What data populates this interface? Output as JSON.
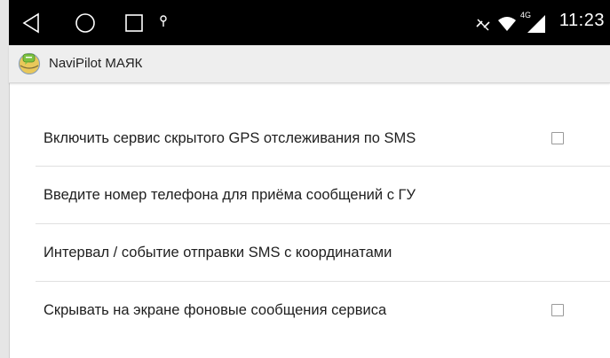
{
  "status_bar": {
    "time": "11:23",
    "network_type": "4G",
    "icons": [
      "back-icon",
      "home-icon",
      "recents-icon",
      "location-icon",
      "data-off-icon",
      "wifi-icon",
      "signal-icon"
    ]
  },
  "app_bar": {
    "title": "NaviPilot МАЯК"
  },
  "settings": {
    "items": [
      {
        "label": "Включить сервис скрытого GPS отслеживания по SMS",
        "has_checkbox": true,
        "checked": false
      },
      {
        "label": "Введите номер телефона для приёма сообщений с ГУ",
        "has_checkbox": false
      },
      {
        "label": "Интервал / событие отправки SMS с координатами",
        "has_checkbox": false
      },
      {
        "label": "Скрывать на экране фоновые сообщения сервиса",
        "has_checkbox": true,
        "checked": false
      }
    ]
  }
}
